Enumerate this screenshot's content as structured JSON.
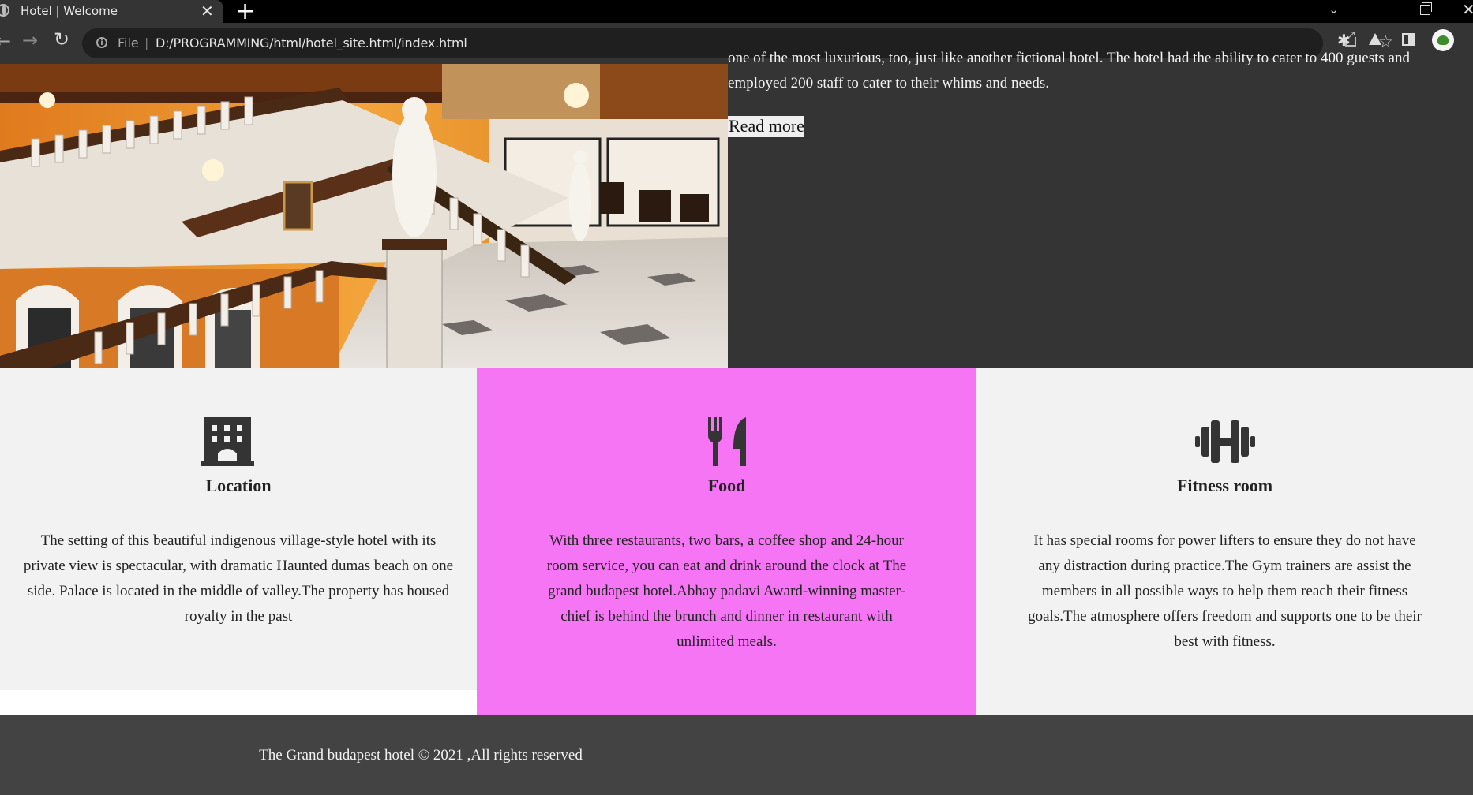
{
  "browser": {
    "tab_title": "Hotel | Welcome",
    "tab_close": "✕",
    "new_tab": "+",
    "scheme_label": "File",
    "url": "D:/PROGRAMMING/html/hotel_site.html/index.html",
    "icons": [
      "globe-icon",
      "close-icon",
      "plus-icon",
      "chevron-down-icon",
      "minimize-icon",
      "restore-icon",
      "close-window-icon",
      "back-arrow-icon",
      "forward-arrow-icon",
      "reload-icon",
      "info-icon",
      "share-icon",
      "star-icon",
      "puzzle-icon",
      "flask-icon",
      "side-panel-icon",
      "avatar",
      "menu-dots-icon"
    ]
  },
  "hero": {
    "text": "one of the most luxurious, too, just like another fictional hotel. The hotel had the ability to cater to 400 guests and employed 200 staff to cater to their whims and needs.",
    "read_more": "Read more"
  },
  "features": [
    {
      "icon": "building-icon",
      "title": "Location",
      "text": "The setting of this beautiful indigenous village-style hotel with its private view is spectacular, with dramatic Haunted dumas beach on one side. Palace is located in the middle of valley.The property has housed royalty in the past",
      "bg": "#f2f2f2"
    },
    {
      "icon": "utensils-icon",
      "title": "Food",
      "text": "With three restaurants, two bars, a coffee shop and 24-hour room service, you can eat and drink around the clock at The grand budapest hotel.Abhay padavi Award-winning master-chief is behind the brunch and dinner in restaurant with unlimited meals.",
      "bg": "#f575f4"
    },
    {
      "icon": "dumbbell-icon",
      "title": "Fitness room",
      "text": "It has special rooms for power lifters to ensure they do not have any distraction during practice.The Gym trainers are assist the members in all possible ways to help them reach their fitness goals.The atmosphere offers freedom and supports one to be their best with fitness.",
      "bg": "#f2f2f2"
    }
  ],
  "footer": {
    "text": "The Grand budapest hotel © 2021 ,All rights reserved"
  },
  "colors": {
    "dark_panel": "#343434",
    "footer": "#434343",
    "accent_pink": "#f575f4",
    "light_panel": "#f2f2f2"
  }
}
